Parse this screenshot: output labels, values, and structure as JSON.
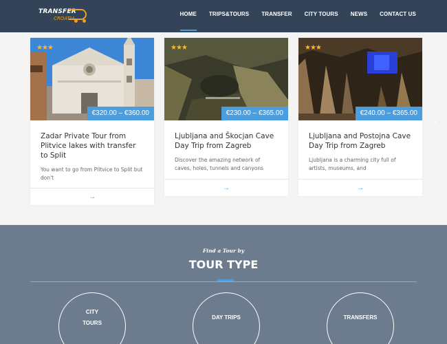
{
  "header": {
    "logo_line1": "TRANSFER",
    "logo_line2": "CROATIA",
    "nav": [
      "HOME",
      "TRIPS&TOURS",
      "TRANSFER",
      "CITY TOURS",
      "NEWS",
      "CONTACT US"
    ],
    "active_nav": "HOME"
  },
  "carousel": {
    "prev_icon": "‹",
    "next_icon": "›"
  },
  "cards": [
    {
      "stars": "★★★",
      "price": "€320.00 – €360.00",
      "title": "Zadar Private Tour from Plitvice lakes with transfer to Split",
      "desc": "You want to go from Plitvice to Split but don't",
      "arrow": "→"
    },
    {
      "stars": "★★★",
      "price": "€230.00 – €365.00",
      "title": "Ljubljana and Škocjan Cave Day Trip from Zagreb",
      "desc": "Discover the amazing network of caves, holes, tunnels and canyons",
      "arrow": "→"
    },
    {
      "stars": "★★★",
      "price": "€240.00 – €365.00",
      "title": "Ljubljana and Postojna Cave Day Trip from Zagreb",
      "desc": "Ljubljana is a charming city full of artists, museums, and",
      "arrow": "→"
    }
  ],
  "tour_type": {
    "subtitle": "Find a Tour by",
    "title": "TOUR TYPE",
    "items": [
      {
        "line1": "CITY",
        "line2": "TOURS"
      },
      {
        "line1": "DAY TRIPS",
        "line2": ""
      },
      {
        "line1": "TRANSFERS",
        "line2": ""
      }
    ]
  },
  "colors": {
    "header_bg": "#334459",
    "accent": "#4a9ee0",
    "section_bg": "#6c7b8d",
    "star": "#f7b731"
  }
}
